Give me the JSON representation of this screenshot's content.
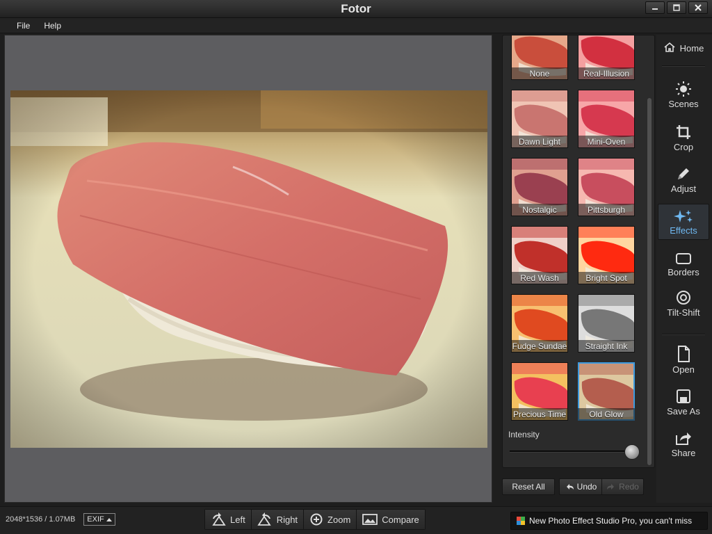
{
  "window": {
    "title": "Fotor",
    "controls": [
      "minimize",
      "maximize",
      "close"
    ]
  },
  "menu": {
    "items": [
      "File",
      "Help"
    ]
  },
  "effects": {
    "items": [
      {
        "label": "None"
      },
      {
        "label": "Real-Illusion"
      },
      {
        "label": "Dawn Light"
      },
      {
        "label": "Mini-Oven"
      },
      {
        "label": "Nostalgic"
      },
      {
        "label": "Pittsburgh"
      },
      {
        "label": "Red Wash"
      },
      {
        "label": "Bright Spot"
      },
      {
        "label": "Fudge Sundae"
      },
      {
        "label": "Straight Ink"
      },
      {
        "label": "Precious Time"
      },
      {
        "label": "Old Glow"
      }
    ],
    "selected": "Old Glow",
    "intensity_label": "Intensity",
    "intensity_value": 1.0
  },
  "panel_actions": {
    "reset_all": "Reset All",
    "undo": "Undo",
    "redo": "Redo"
  },
  "sidebar": {
    "home": "Home",
    "items": [
      {
        "label": "Scenes",
        "icon": "sun-icon"
      },
      {
        "label": "Crop",
        "icon": "crop-icon"
      },
      {
        "label": "Adjust",
        "icon": "pencil-icon"
      },
      {
        "label": "Effects",
        "icon": "sparkle-icon"
      },
      {
        "label": "Borders",
        "icon": "border-icon"
      },
      {
        "label": "Tilt-Shift",
        "icon": "target-icon"
      },
      {
        "label": "Open",
        "icon": "file-icon"
      },
      {
        "label": "Save As",
        "icon": "save-icon"
      },
      {
        "label": "Share",
        "icon": "share-icon"
      }
    ],
    "active": "Effects"
  },
  "status": {
    "dimensions": "2048*1536 / 1.07MB",
    "exif": "EXIF"
  },
  "toolbar": {
    "left": "Left",
    "right": "Right",
    "zoom": "Zoom",
    "compare": "Compare"
  },
  "promo": {
    "text": "New Photo Effect Studio Pro, you can't miss"
  },
  "colors": {
    "accent": "#3d9be0",
    "active_text": "#6fb9f2",
    "canvas_bg": "#5d5d60"
  }
}
